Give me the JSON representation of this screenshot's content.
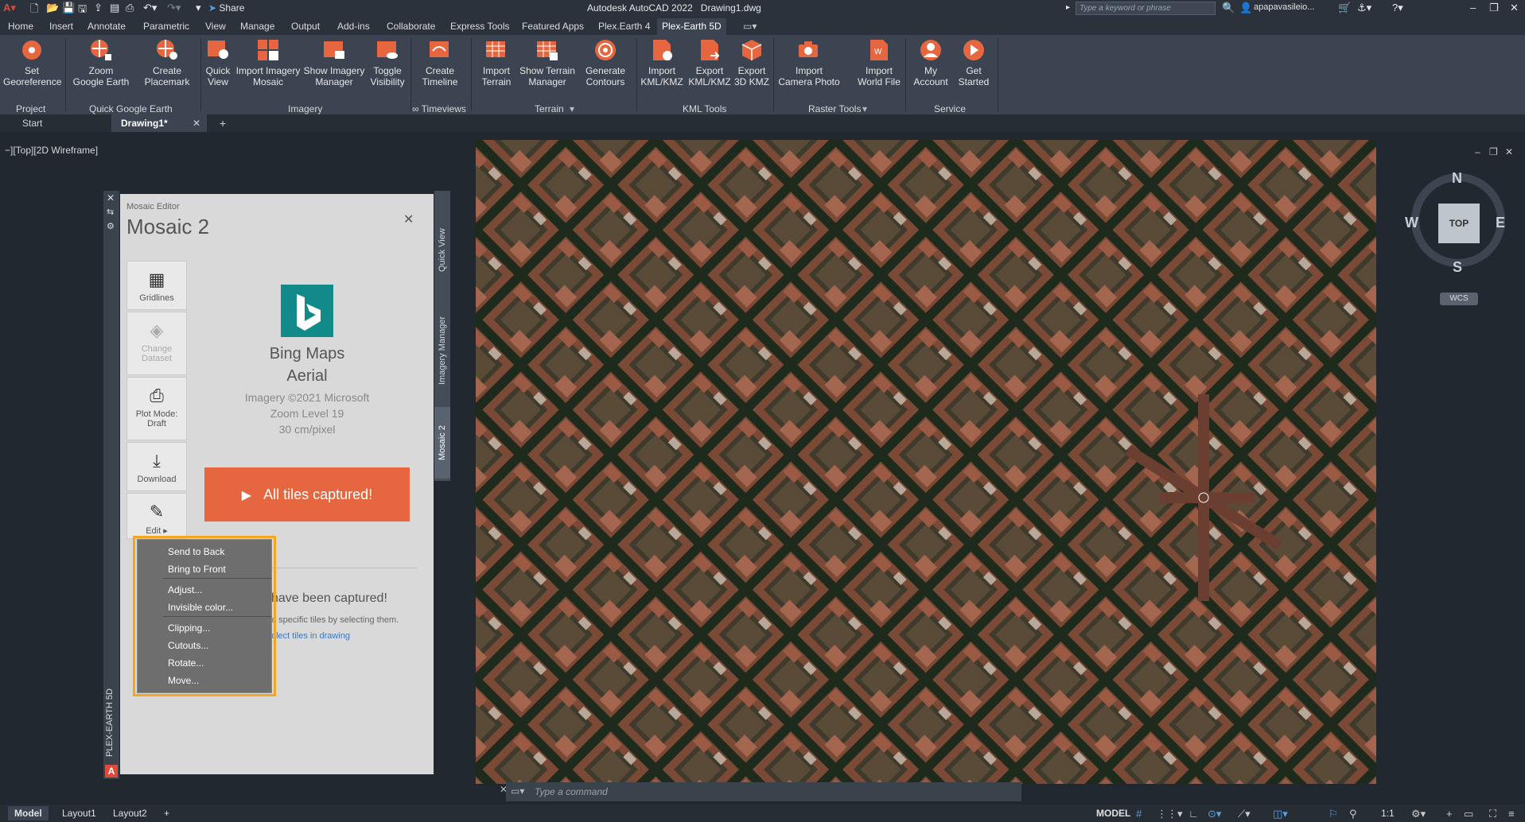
{
  "titlebar": {
    "app_title": "Autodesk AutoCAD 2022",
    "file_title": "Drawing1.dwg",
    "share_label": "Share",
    "search_placeholder": "Type a keyword or phrase",
    "user": "apapavasileio..."
  },
  "ribbon_tabs": [
    "Home",
    "Insert",
    "Annotate",
    "Parametric",
    "View",
    "Manage",
    "Output",
    "Add-ins",
    "Collaborate",
    "Express Tools",
    "Featured Apps",
    "Plex.Earth 4",
    "Plex-Earth 5D"
  ],
  "ribbon": {
    "buttons": [
      {
        "l1": "Set",
        "l2": "Georeference"
      },
      {
        "l1": "Zoom",
        "l2": "Google Earth"
      },
      {
        "l1": "Create",
        "l2": "Placemark"
      },
      {
        "l1": "Quick",
        "l2": "View"
      },
      {
        "l1": "Import Imagery",
        "l2": "Mosaic"
      },
      {
        "l1": "Show Imagery",
        "l2": "Manager"
      },
      {
        "l1": "Toggle",
        "l2": "Visibility"
      },
      {
        "l1": "Create",
        "l2": "Timeline"
      },
      {
        "l1": "Import",
        "l2": "Terrain"
      },
      {
        "l1": "Show Terrain",
        "l2": "Manager"
      },
      {
        "l1": "Generate",
        "l2": "Contours"
      },
      {
        "l1": "Import",
        "l2": "KML/KMZ"
      },
      {
        "l1": "Export",
        "l2": "KML/KMZ"
      },
      {
        "l1": "Export",
        "l2": "3D KMZ"
      },
      {
        "l1": "Import",
        "l2": "Camera Photo"
      },
      {
        "l1": "Import",
        "l2": "World File"
      },
      {
        "l1": "My",
        "l2": "Account"
      },
      {
        "l1": "Get",
        "l2": "Started"
      }
    ],
    "panels": [
      "Project",
      "Quick Google Earth",
      "Imagery",
      "∞ Timeviews",
      "Terrain",
      "KML Tools",
      "Raster Tools",
      "Service"
    ]
  },
  "doc_tabs": {
    "start": "Start",
    "active": "Drawing1*",
    "close": "✕",
    "add": "+"
  },
  "viewport_label": "−][Top][2D Wireframe]",
  "viewcube": {
    "n": "N",
    "s": "S",
    "e": "E",
    "w": "W",
    "top": "TOP",
    "wcs": "WCS"
  },
  "palette": {
    "strip_label": "PLEX-EARTH 5D",
    "header_small": "Mosaic Editor",
    "title": "Mosaic 2",
    "close": "✕",
    "side_tabs": [
      "Quick View",
      "Imagery Manager",
      "Mosaic 2"
    ],
    "tools": [
      {
        "label": "Gridlines",
        "icon": "▦"
      },
      {
        "label": "Change Dataset",
        "icon": "◈"
      },
      {
        "label": "Plot Mode: Draft",
        "icon": "⎙"
      },
      {
        "label": "Download",
        "icon": "⤓"
      },
      {
        "label": "Edit ▸",
        "icon": "✎"
      }
    ],
    "provider": "Bing Maps",
    "provider2": "Aerial",
    "copyright": "Imagery ©2021 Microsoft",
    "zoom": "Zoom Level 19",
    "resolution": "30 cm/pixel",
    "capture_button": "All tiles captured!",
    "captured_text": "have been captured!",
    "hint_text": "e specific tiles by selecting them.",
    "link_text": "elect tiles in drawing"
  },
  "context_menu": [
    "Send to Back",
    "Bring to Front",
    "Adjust...",
    "Invisible color...",
    "Clipping...",
    "Cutouts...",
    "Rotate...",
    "Move..."
  ],
  "command_line": {
    "placeholder": "Type a command"
  },
  "status_bar": {
    "tabs": [
      "Model",
      "Layout1",
      "Layout2",
      "+"
    ],
    "model_label": "MODEL",
    "scale": "1:1"
  },
  "colors": {
    "accent": "#e6673f",
    "highlight": "#f4a623",
    "bing": "#138a8a"
  }
}
